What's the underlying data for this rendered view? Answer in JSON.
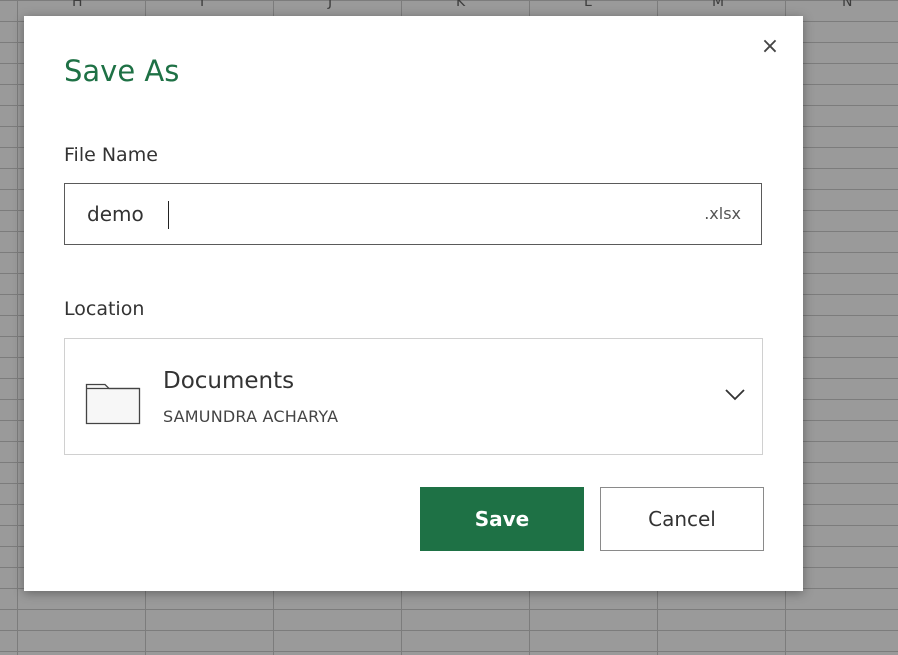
{
  "background": {
    "column_letters": [
      "H",
      "I",
      "J",
      "K",
      "L",
      "M",
      "N"
    ]
  },
  "dialog": {
    "title": "Save As",
    "close_icon": "×",
    "file_name": {
      "label": "File Name",
      "value": "demo",
      "extension": ".xlsx"
    },
    "location": {
      "label": "Location",
      "folder_name": "Documents",
      "owner": "SAMUNDRA ACHARYA",
      "icon": "folder-icon"
    },
    "buttons": {
      "save": "Save",
      "cancel": "Cancel"
    }
  },
  "colors": {
    "accent": "#1e7145",
    "overlay_background": "#9a9a9a"
  }
}
